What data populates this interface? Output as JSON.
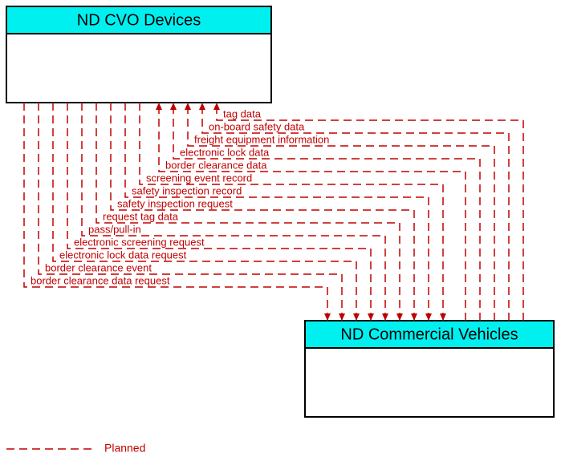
{
  "boxes": {
    "top": {
      "title": "ND CVO Devices"
    },
    "bottom": {
      "title": "ND Commercial Vehicles"
    }
  },
  "legend": {
    "planned": "Planned"
  },
  "colors": {
    "line": "#c00000",
    "boxHeader": "#00f0f0"
  },
  "flows_to_top": [
    {
      "label": "border clearance data"
    },
    {
      "label": "electronic lock data"
    },
    {
      "label": "freight equipment information"
    },
    {
      "label": "on-board safety data"
    },
    {
      "label": "tag data"
    }
  ],
  "flows_to_bottom": [
    {
      "label": "border clearance data request"
    },
    {
      "label": "border clearance event"
    },
    {
      "label": "electronic lock data request"
    },
    {
      "label": "electronic screening request"
    },
    {
      "label": "pass/pull-in"
    },
    {
      "label": "request tag data"
    },
    {
      "label": "safety inspection request"
    },
    {
      "label": "safety inspection record"
    },
    {
      "label": "screening event record"
    }
  ]
}
